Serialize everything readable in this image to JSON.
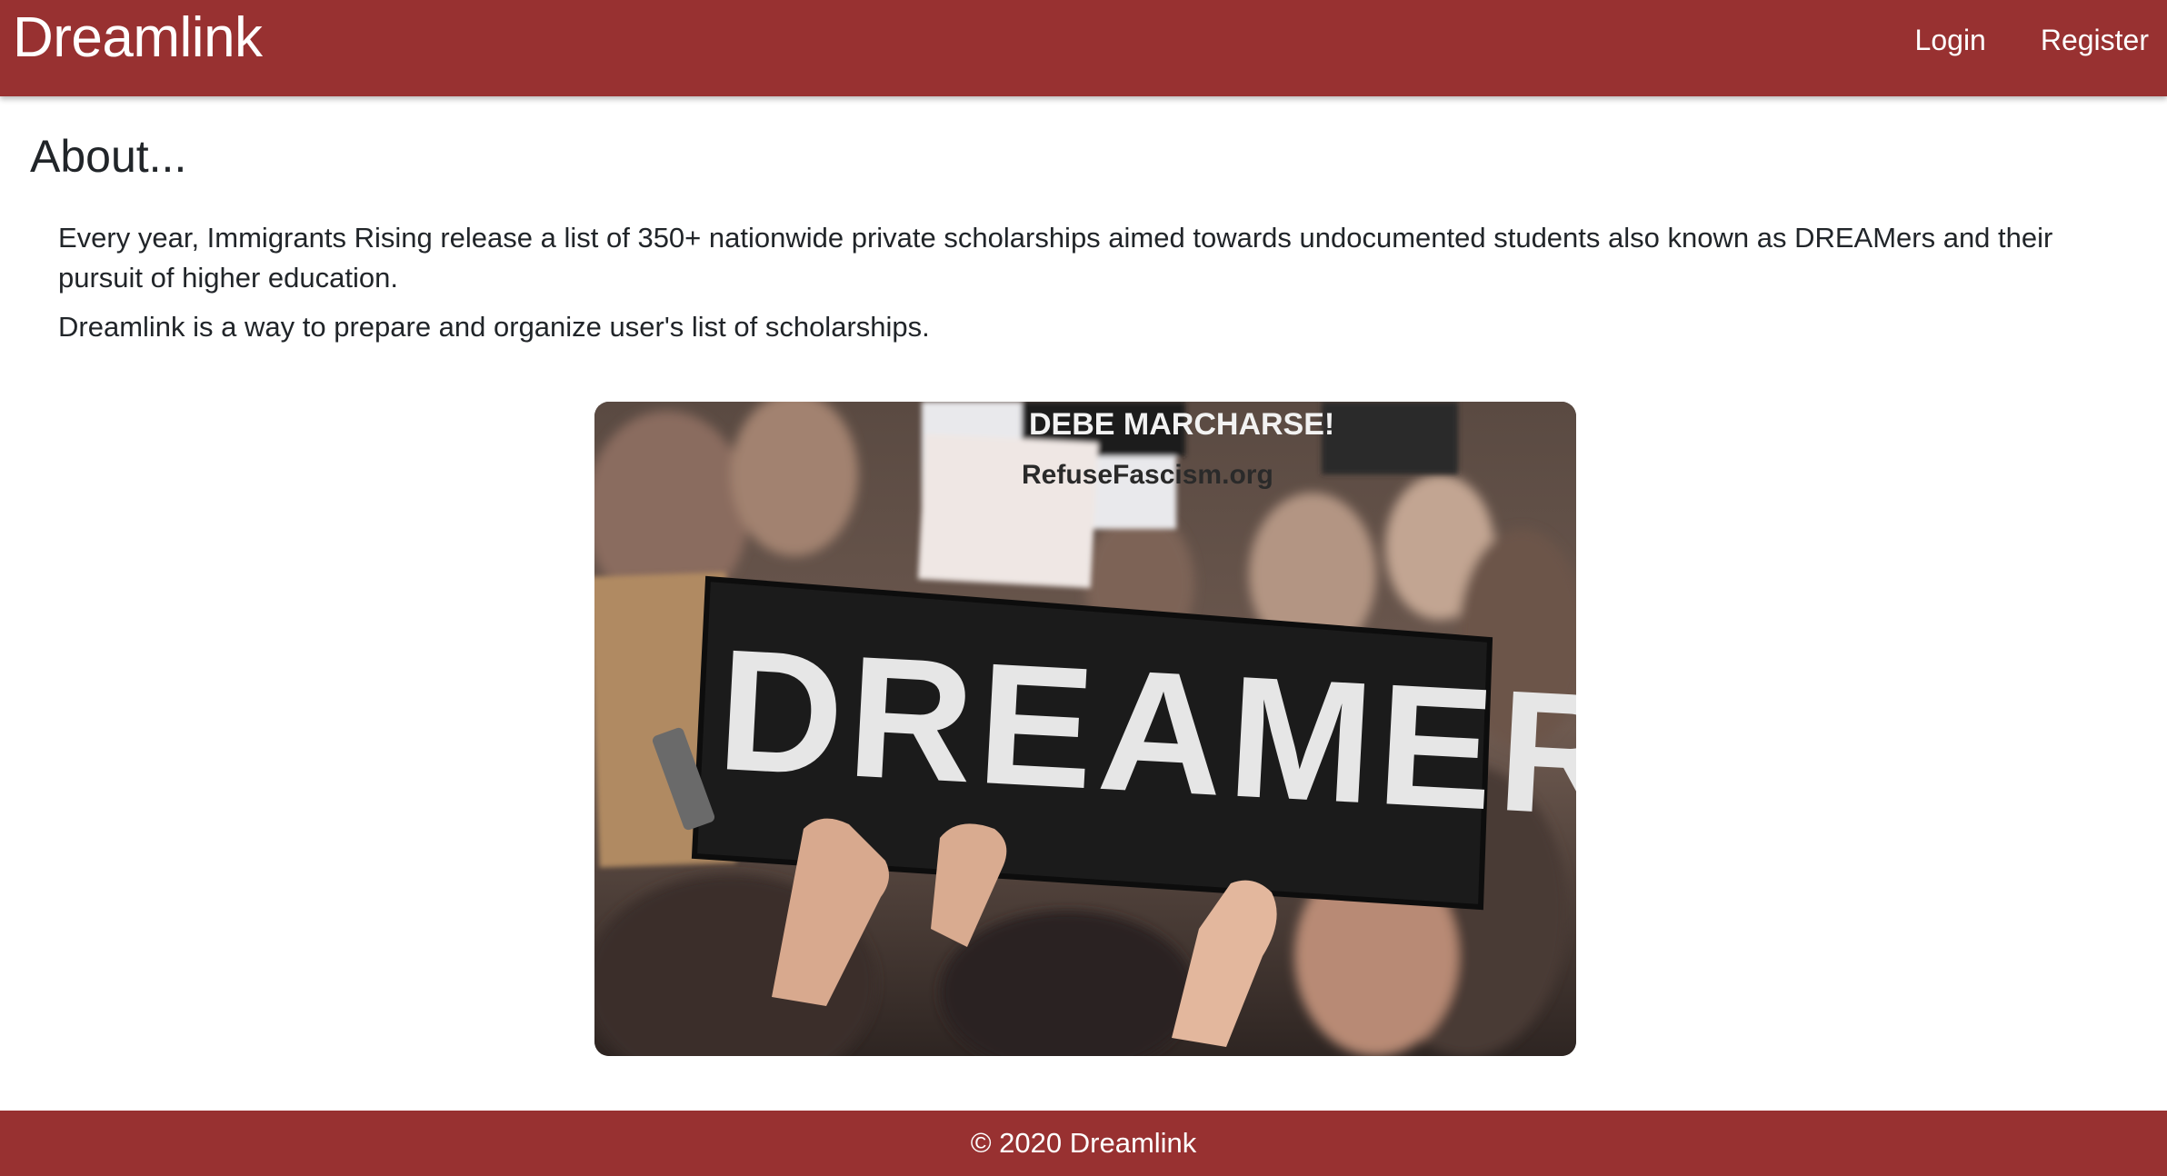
{
  "navbar": {
    "brand": "Dreamlink",
    "links": [
      {
        "label": "Login"
      },
      {
        "label": "Register"
      }
    ],
    "background_color": "#983131"
  },
  "about": {
    "title": "About...",
    "paragraphs": [
      "Every year, Immigrants Rising release a list of 350+ nationwide private scholarships aimed towards undocumented students also known as DREAMers and their pursuit of higher education.",
      "Dreamlink is a way to prepare and organize user's list of scholarships."
    ]
  },
  "hero_image": {
    "sign_text": "DREAMER",
    "background_sign_lines": [
      "DEBE MARCHARSE!",
      "RefuseFascism.org"
    ],
    "icon": "protest-photo"
  },
  "footer": {
    "text": "© 2020 Dreamlink"
  }
}
